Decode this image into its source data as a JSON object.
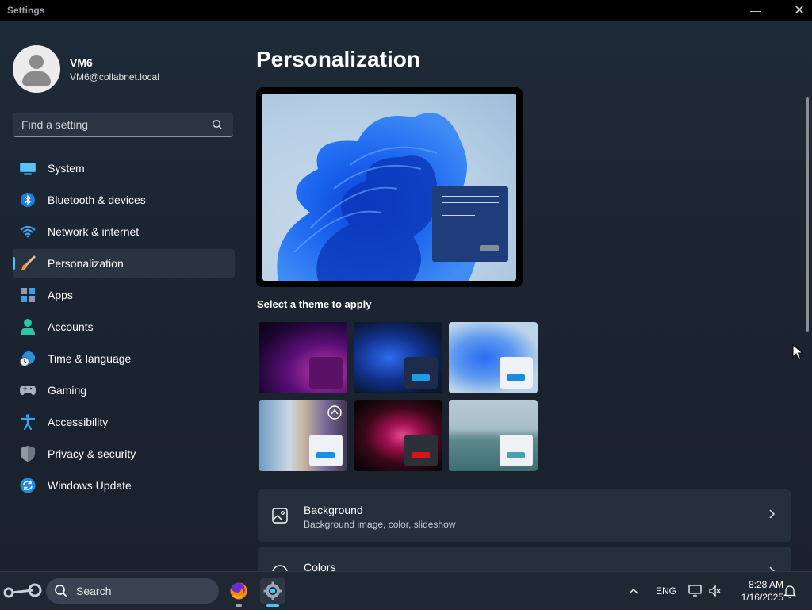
{
  "window": {
    "title": "Settings",
    "minimize": "—",
    "close": "✕"
  },
  "user": {
    "name": "VM6",
    "email": "VM6@collabnet.local"
  },
  "search": {
    "placeholder": "Find a setting"
  },
  "nav": [
    {
      "label": "System",
      "icon": "monitor-icon"
    },
    {
      "label": "Bluetooth & devices",
      "icon": "bluetooth-icon"
    },
    {
      "label": "Network & internet",
      "icon": "wifi-icon"
    },
    {
      "label": "Personalization",
      "icon": "brush-icon",
      "active": true
    },
    {
      "label": "Apps",
      "icon": "apps-icon"
    },
    {
      "label": "Accounts",
      "icon": "person-icon"
    },
    {
      "label": "Time & language",
      "icon": "globe-clock-icon"
    },
    {
      "label": "Gaming",
      "icon": "controller-icon"
    },
    {
      "label": "Accessibility",
      "icon": "accessibility-icon"
    },
    {
      "label": "Privacy & security",
      "icon": "shield-icon"
    },
    {
      "label": "Windows Update",
      "icon": "update-icon"
    }
  ],
  "main": {
    "title": "Personalization",
    "theme_label": "Select a theme to apply",
    "themes": [
      {
        "name": "glow",
        "accent": "#5b1166"
      },
      {
        "name": "windows-dark",
        "accent": "#1a9ee6"
      },
      {
        "name": "windows-light",
        "accent": "#1a8ce0"
      },
      {
        "name": "captured-motion",
        "accent": "#1b8fe3"
      },
      {
        "name": "flow",
        "accent": "#e0101b"
      },
      {
        "name": "sunrise",
        "accent": "#4a9fb0"
      }
    ],
    "cards": [
      {
        "title": "Background",
        "subtitle": "Background image, color, slideshow",
        "icon": "image-icon"
      },
      {
        "title": "Colors",
        "subtitle": "",
        "icon": "palette-icon"
      }
    ]
  },
  "taskbar": {
    "search_label": "Search",
    "language": "ENG",
    "time": "8:28 AM",
    "date": "1/16/2025"
  },
  "colors": {
    "accent": "#4cc2ff",
    "background": "#1c2430"
  }
}
